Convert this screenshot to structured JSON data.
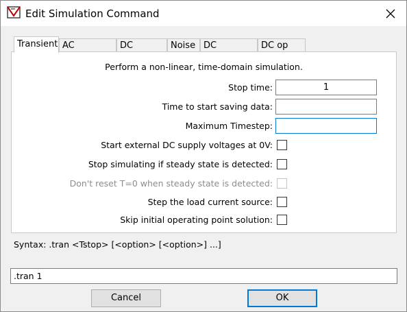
{
  "window": {
    "title": "Edit Simulation Command",
    "icon": "ltspice-app-icon",
    "close_icon": "close-icon"
  },
  "tabs": [
    {
      "label": "Transient",
      "selected": true
    },
    {
      "label": "AC Analysis",
      "selected": false
    },
    {
      "label": "DC sweep",
      "selected": false
    },
    {
      "label": "Noise",
      "selected": false
    },
    {
      "label": "DC Transfer",
      "selected": false
    },
    {
      "label": "DC op pnt",
      "selected": false
    }
  ],
  "transient": {
    "description": "Perform a non-linear, time-domain simulation.",
    "stop_time_label": "Stop time:",
    "stop_time_value": "1",
    "start_saving_label": "Time to start saving data:",
    "start_saving_value": "",
    "max_timestep_label": "Maximum Timestep:",
    "max_timestep_value": "",
    "options": [
      {
        "label": "Start external DC supply voltages at 0V:",
        "checked": false,
        "enabled": true
      },
      {
        "label": "Stop simulating if steady state is detected:",
        "checked": false,
        "enabled": true
      },
      {
        "label": "Don't reset T=0 when steady state is detected:",
        "checked": false,
        "enabled": false
      },
      {
        "label": "Step the load current source:",
        "checked": false,
        "enabled": true
      },
      {
        "label": "Skip initial operating point solution:",
        "checked": false,
        "enabled": true
      }
    ]
  },
  "syntax": "Syntax:  .tran <Tstop> [<option> [<option>] ...]",
  "command": ".tran 1",
  "buttons": {
    "cancel": "Cancel",
    "ok": "OK"
  },
  "colors": {
    "focus_border": "#0078d7",
    "disabled_text": "#8d8d8d"
  }
}
